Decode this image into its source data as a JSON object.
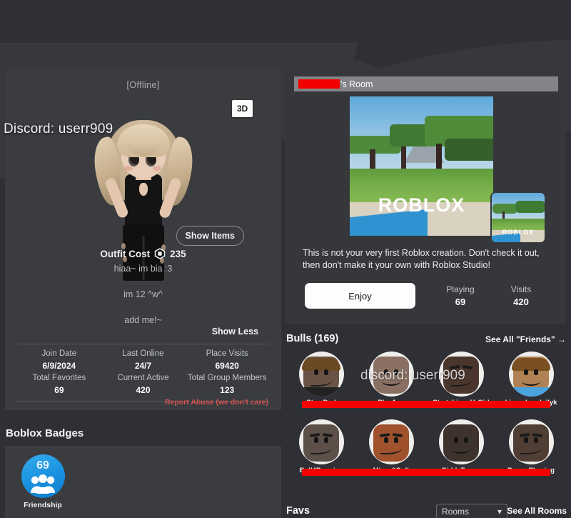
{
  "profile": {
    "status": "[Offline]",
    "view_3d_label": "3D",
    "show_items_label": "Show Items",
    "outfit_cost_label": "Outfit Cost",
    "outfit_cost_value": "235",
    "bio_lines": [
      "hiaa~ im bia :3",
      "im 12 ^w^",
      "add me!~"
    ],
    "show_less_label": "Show Less",
    "discord_overlay": "Discord: userr909",
    "report_abuse": "Report Abuse (we don't care)",
    "stats": {
      "row1": [
        {
          "label": "Join Date",
          "value": "6/9/2024"
        },
        {
          "label": "Last Online",
          "value": "24/7"
        },
        {
          "label": "Place Visits",
          "value": "69420"
        }
      ],
      "row2": [
        {
          "label": "Total Favorites",
          "value": "69"
        },
        {
          "label": "Current Active",
          "value": "420"
        },
        {
          "label": "Total Group Members",
          "value": "123"
        }
      ]
    }
  },
  "badges": {
    "title": "Boblox Badges",
    "items": [
      {
        "name": "Friendship",
        "count": "69",
        "color": "#1b93e0"
      }
    ]
  },
  "game": {
    "title_suffix": "'s Room",
    "title_censored": true,
    "logo_text": "ROBLOX",
    "description": "This is not your very first Roblox creation. Don't check it out, then don't make it your own with Roblox Studio!",
    "play_button": "Enjoy",
    "stats": [
      {
        "label": "Playing",
        "value": "69"
      },
      {
        "label": "Visits",
        "value": "420"
      }
    ]
  },
  "friends": {
    "heading": "Bulls (169)",
    "see_all": "See All \"Friends\" →",
    "watermark": "discord: userr909",
    "rows": [
      [
        {
          "name": "Step Dad",
          "skin": "#6a5346",
          "hair": "#6b4a23",
          "shirt": "#222222"
        },
        {
          "name": "PlayAge",
          "skin": "#8a7062",
          "hair": "",
          "shirt": "#8a7062"
        },
        {
          "name": "Stretching_UrGirl",
          "skin": "#4a362c",
          "hair": "",
          "shirt": "#4a362c"
        },
        {
          "name": "bigandreadyifyk",
          "skin": "#b08154",
          "hair": "#7a4f22",
          "shirt": "#4aa3dd"
        }
      ],
      [
        {
          "name": "Bull4Bunnies",
          "skin": "#5d5048",
          "hair": "",
          "shirt": "#5d5048"
        },
        {
          "name": "Micro&Soft",
          "skin": "#a0522d",
          "hair": "",
          "shirt": "#a0522d"
        },
        {
          "name": "DiddyTyson",
          "skin": "#3d332c",
          "hair": "",
          "shirt": "#3d332c"
        },
        {
          "name": "BunnyPlowing",
          "skin": "#4f3e33",
          "hair": "",
          "shirt": "#4f3e33"
        }
      ]
    ]
  },
  "favs": {
    "heading": "Favs",
    "filter_value": "Rooms",
    "see_all": "See All Rooms"
  },
  "colors": {
    "censor": "#f50000",
    "panel": "#3a3c40",
    "page_bg": "#2e3035",
    "accent_red": "#d9534f"
  }
}
